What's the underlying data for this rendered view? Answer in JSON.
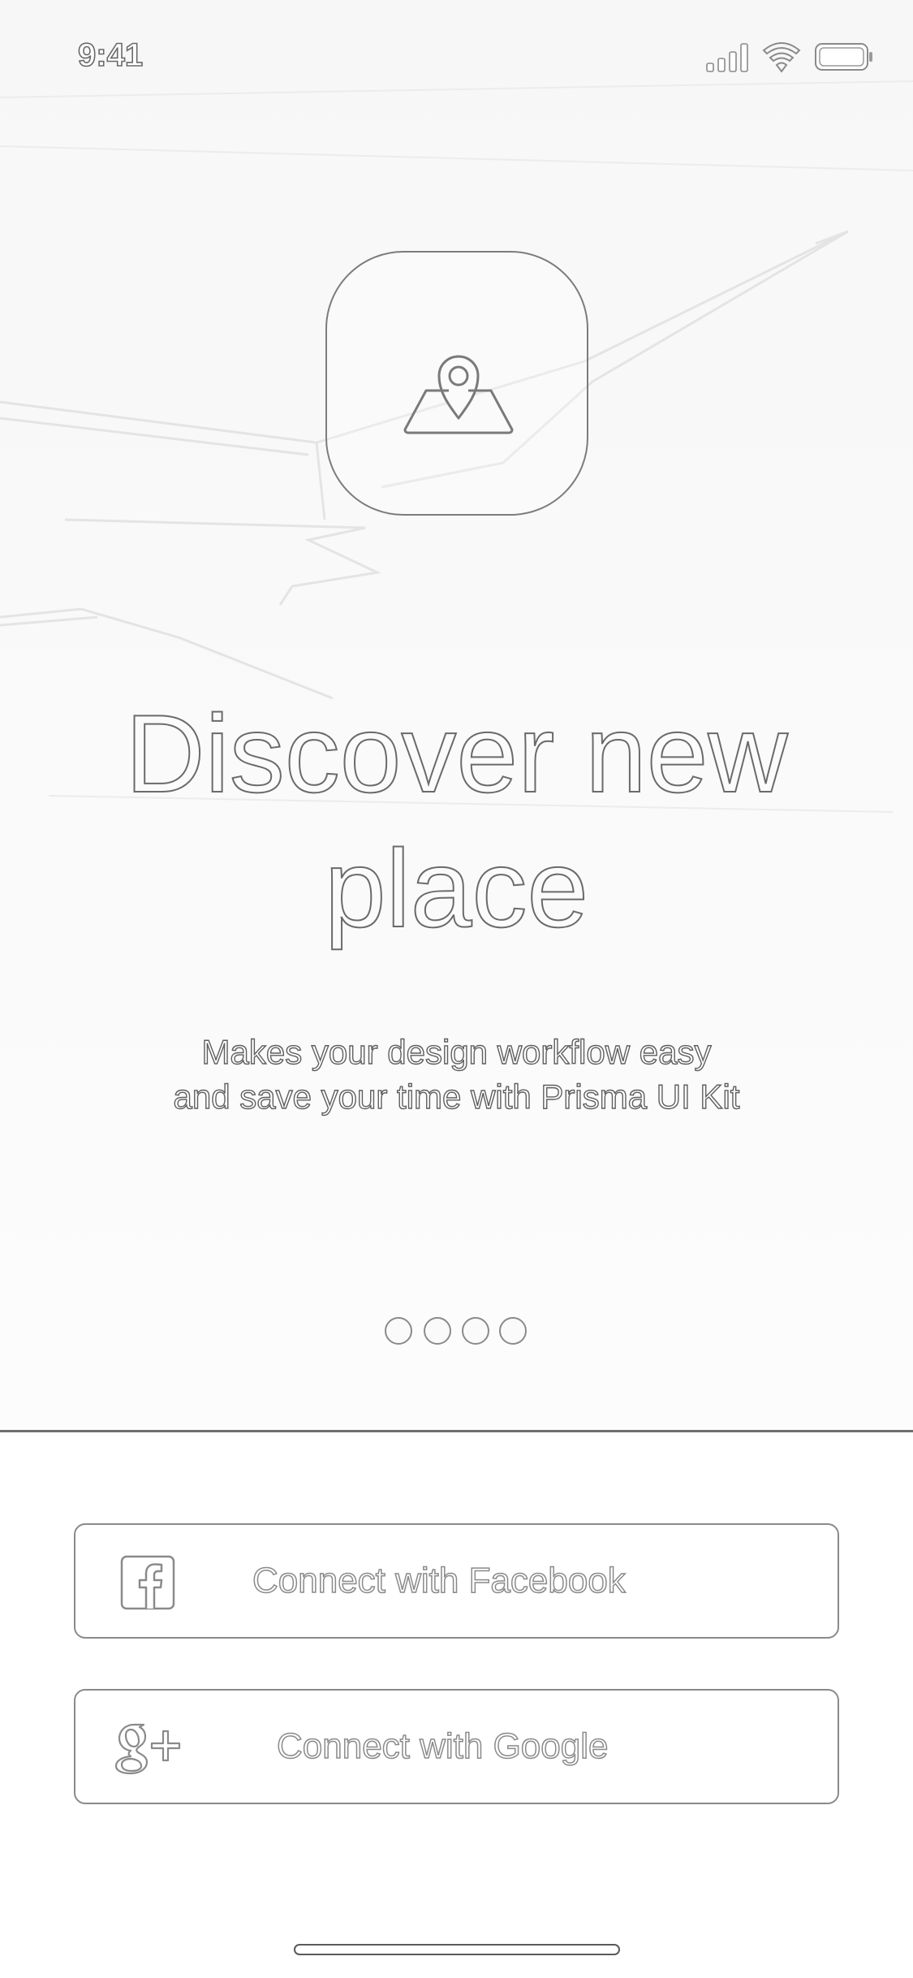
{
  "status_bar": {
    "time": "9:41",
    "icons": [
      "signal-icon",
      "wifi-icon",
      "battery-icon"
    ]
  },
  "hero": {
    "app_icon": "map-pin-icon",
    "title_line1": "Discover new",
    "title_line2": "place",
    "subtitle_line1": "Makes your design workflow easy",
    "subtitle_line2": "and save your time with Prisma UI Kit",
    "pager": {
      "count": 4,
      "active_index": 0
    }
  },
  "actions": {
    "facebook": {
      "label": "Connect with Facebook",
      "icon": "facebook-icon"
    },
    "google": {
      "label": "Connect with Google",
      "icon": "google-plus-icon"
    }
  },
  "colors": {
    "outline": "#6a6a6a",
    "border": "#8a8a8a",
    "background": "#ffffff"
  }
}
